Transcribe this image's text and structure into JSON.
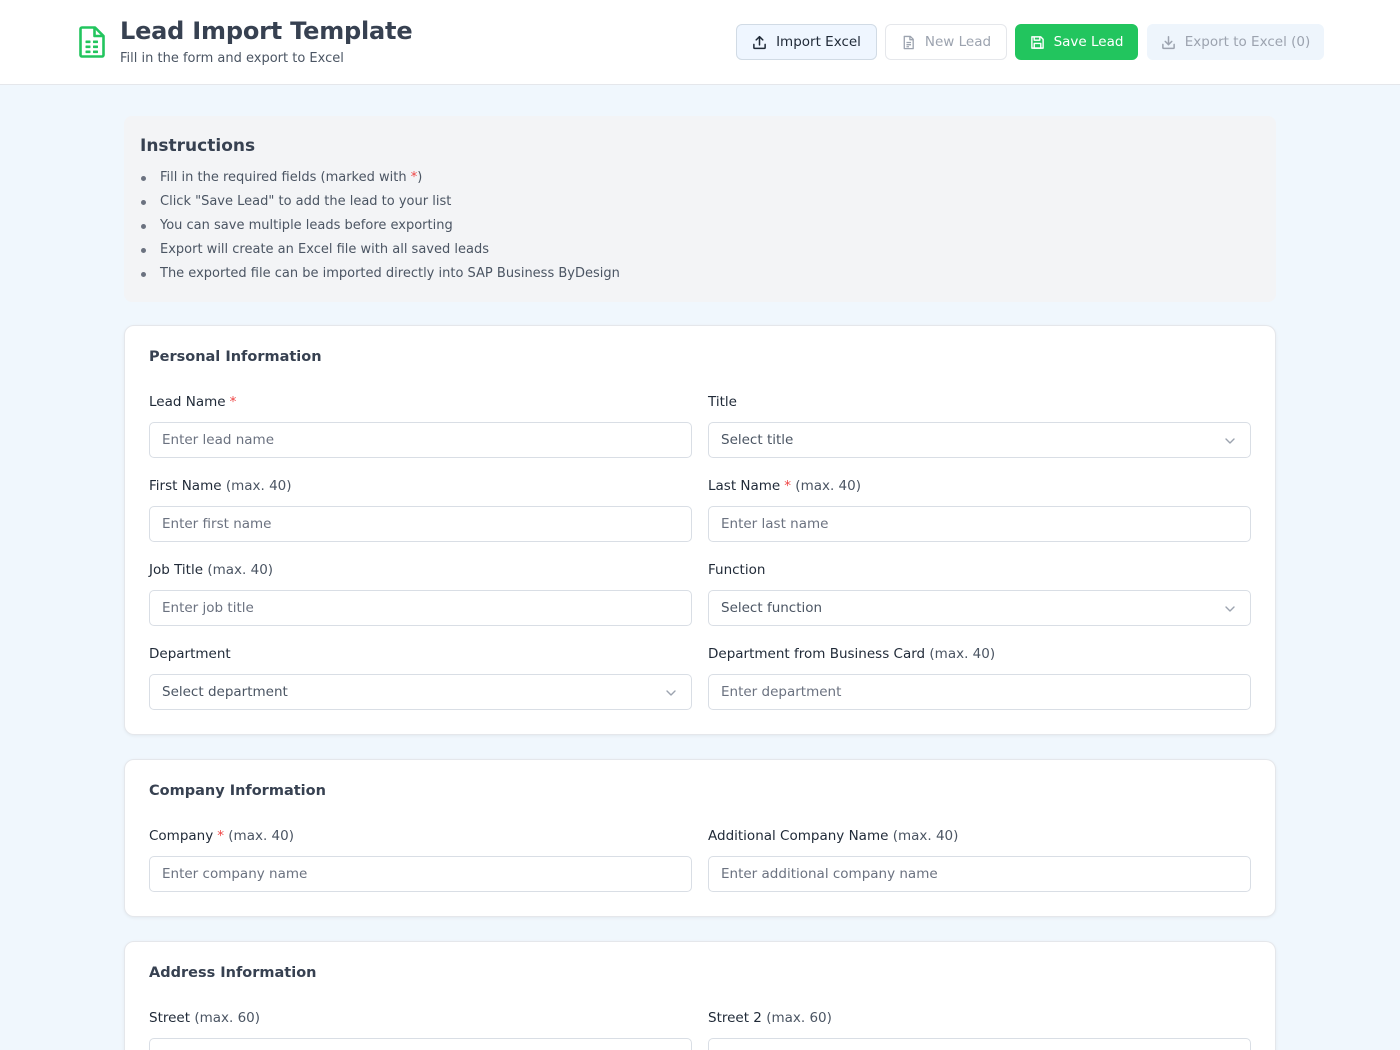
{
  "header": {
    "title": "Lead Import Template",
    "subtitle": "Fill in the form and export to Excel",
    "buttons": {
      "import": "Import Excel",
      "new": "New Lead",
      "save": "Save Lead",
      "export": "Export to Excel (0)"
    }
  },
  "colors": {
    "accent": "#22c55e",
    "required": "#ef4444",
    "page_background": "#f0f7fd"
  },
  "icons": {
    "app": "spreadsheet-icon",
    "import": "upload-icon",
    "new": "document-icon",
    "save": "floppy-disk-icon",
    "export": "download-icon",
    "select": "chevron-down-icon"
  },
  "instructions": {
    "title": "Instructions",
    "items": [
      "Fill in the required fields (marked with ",
      "Click \"Save Lead\" to add the lead to your list",
      "You can save multiple leads before exporting",
      "Export will create an Excel file with all saved leads",
      "The exported file can be imported directly into SAP Business ByDesign"
    ],
    "item0_marker": "*",
    "item0_end": ")"
  },
  "required_marker": "*",
  "personal": {
    "title": "Personal Information",
    "lead_name": {
      "label": "Lead Name",
      "placeholder": "Enter lead name"
    },
    "title_field": {
      "label": "Title",
      "selected": "Select title"
    },
    "first_name": {
      "label": "First Name",
      "hint": "(max. 40)",
      "placeholder": "Enter first name"
    },
    "last_name": {
      "label": "Last Name",
      "hint": "(max. 40)",
      "placeholder": "Enter last name"
    },
    "job_title": {
      "label": "Job Title",
      "hint": "(max. 40)",
      "placeholder": "Enter job title"
    },
    "function": {
      "label": "Function",
      "selected": "Select function"
    },
    "department": {
      "label": "Department",
      "selected": "Select department"
    },
    "department_card": {
      "label": "Department from Business Card",
      "hint": "(max. 40)",
      "placeholder": "Enter department"
    }
  },
  "company": {
    "title": "Company Information",
    "company": {
      "label": "Company",
      "hint": "(max. 40)",
      "placeholder": "Enter company name"
    },
    "additional": {
      "label": "Additional Company Name",
      "hint": "(max. 40)",
      "placeholder": "Enter additional company name"
    }
  },
  "address": {
    "title": "Address Information",
    "street": {
      "label": "Street",
      "hint": "(max. 60)"
    },
    "street2": {
      "label": "Street 2",
      "hint": "(max. 60)"
    }
  }
}
